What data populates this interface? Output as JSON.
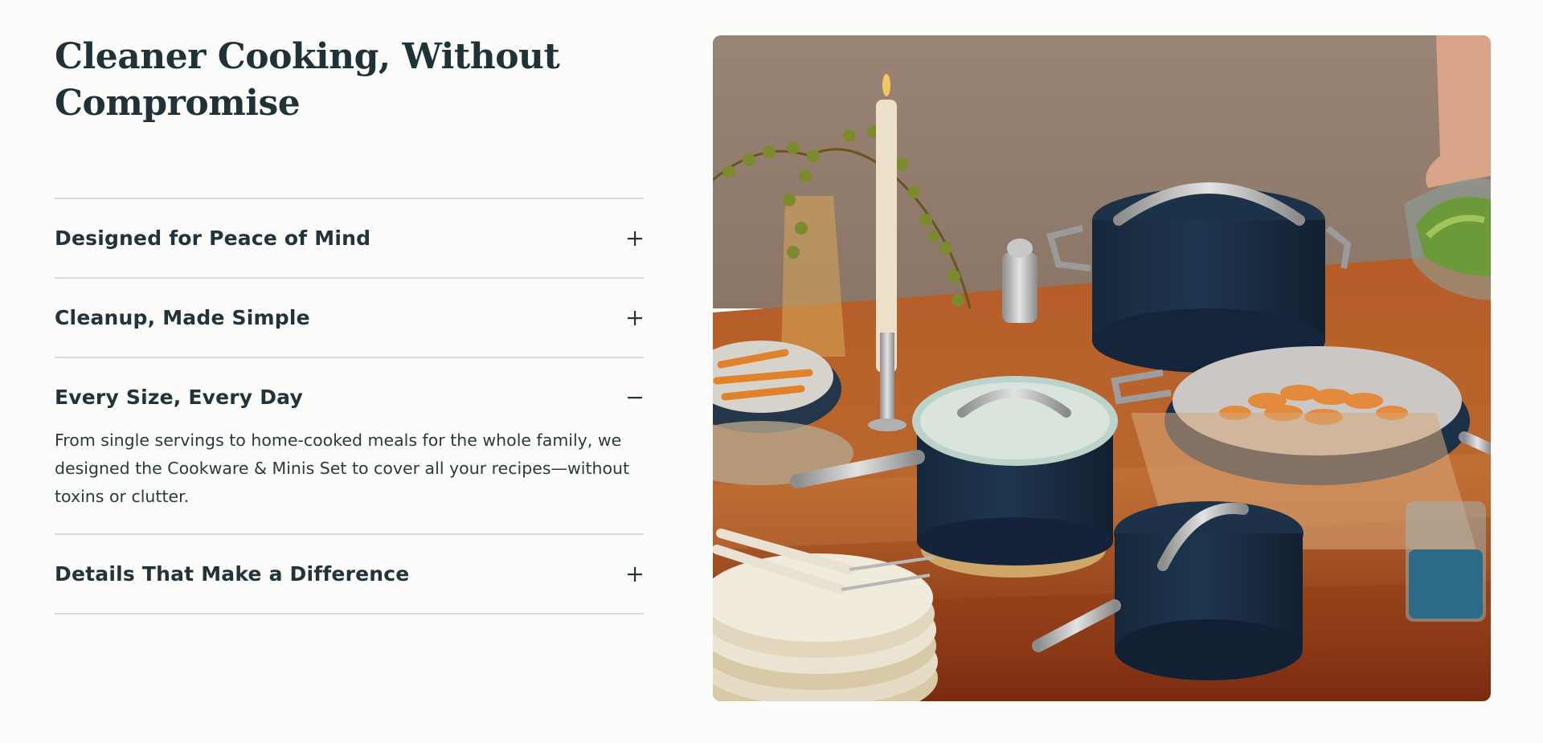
{
  "headline": "Cleaner Cooking, Without Compromise",
  "accordion": {
    "items": [
      {
        "title": "Designed for Peace of Mind",
        "expanded": false,
        "icon": "plus-icon"
      },
      {
        "title": "Cleanup, Made Simple",
        "expanded": false,
        "icon": "plus-icon"
      },
      {
        "title": "Every Size, Every Day",
        "expanded": true,
        "icon": "minus-icon",
        "body": "From single servings to home-cooked meals for the whole family, we designed the Cookware & Minis Set to cover all your recipes—without toxins or clutter."
      },
      {
        "title": "Details That Make a Difference",
        "expanded": false,
        "icon": "plus-icon"
      }
    ]
  },
  "colors": {
    "text": "#22343a",
    "divider": "#d9dcdc",
    "background": "#fcfcfa",
    "cookware_navy": "#1c2f45"
  }
}
